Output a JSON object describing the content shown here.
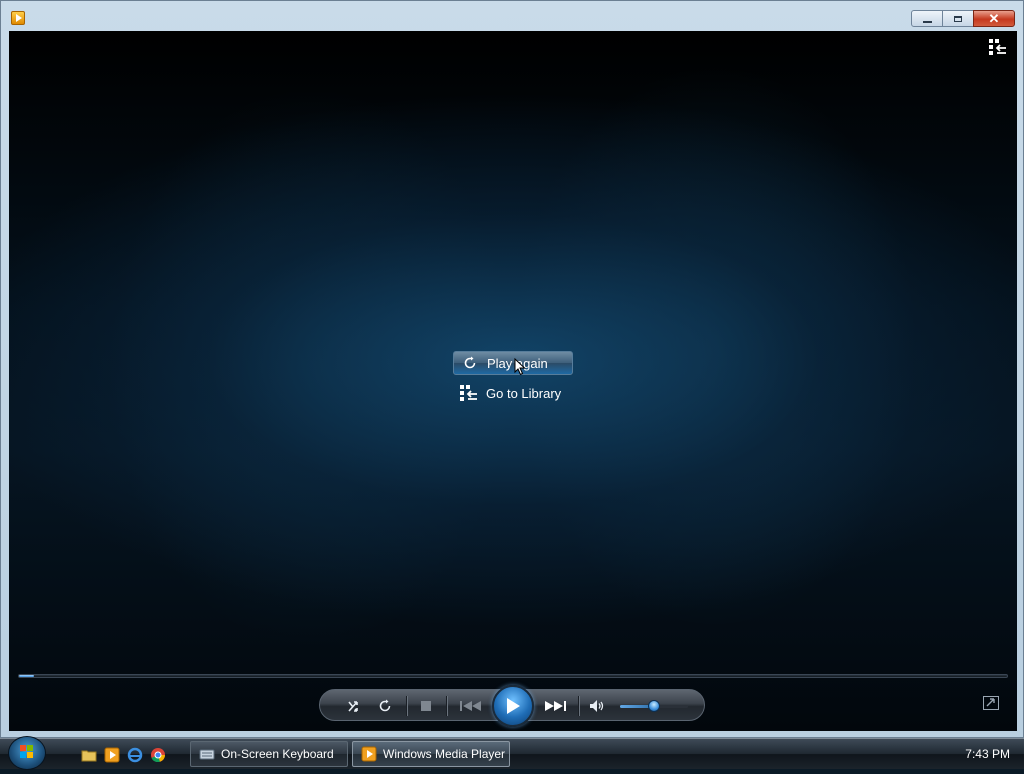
{
  "window": {
    "title_icon": "windows-media-player-icon",
    "caption_buttons": [
      "minimize",
      "maximize",
      "close"
    ]
  },
  "player": {
    "switch_to_library_icon": "switch-to-library-icon",
    "menu": {
      "play_again_label": "Play again",
      "go_to_library_label": "Go to Library"
    },
    "seek_progress": 0.015
  },
  "controls": {
    "icons": [
      "shuffle-icon",
      "repeat-icon",
      "stop-icon",
      "previous-icon",
      "play-icon",
      "next-icon",
      "mute-icon"
    ],
    "volume_level": 0.5,
    "switch_to_now_playing_icon": "switch-to-compact-mode-icon"
  },
  "taskbar": {
    "quick_launch": [
      "windows-explorer-icon",
      "windows-media-player-icon",
      "internet-explorer-icon",
      "chrome-icon"
    ],
    "buttons": [
      {
        "label": "On-Screen Keyboard",
        "icon": "keyboard-icon"
      },
      {
        "label": "Windows Media Player",
        "icon": "windows-media-player-icon"
      }
    ],
    "clock": "7:43 PM"
  },
  "colors": {
    "accent": "#1f69a3",
    "play_button": "#2a82d0",
    "taskbar": "#1f2831"
  }
}
